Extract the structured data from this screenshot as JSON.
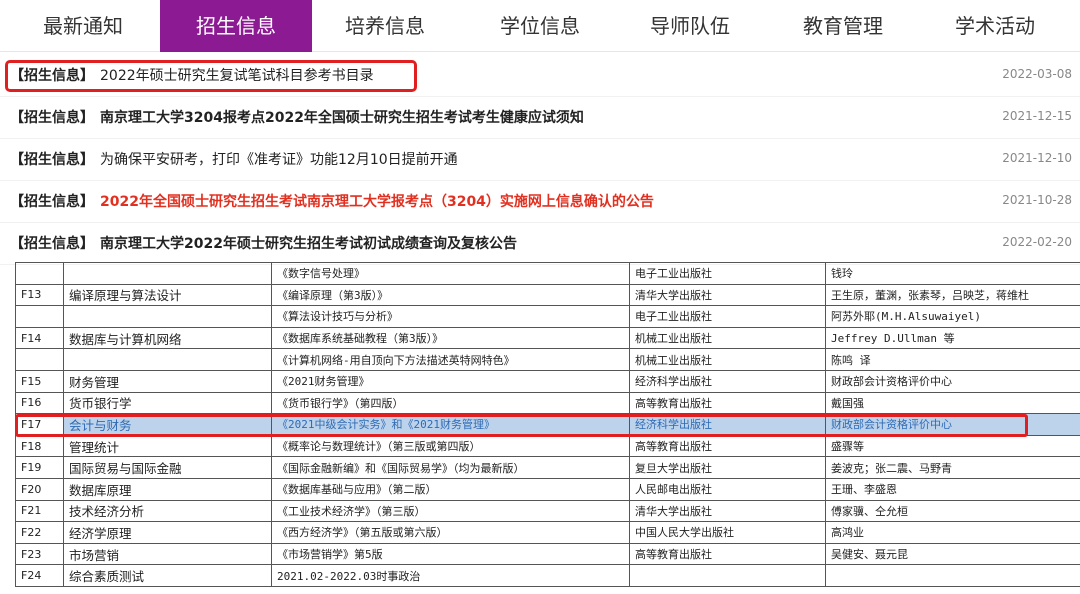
{
  "nav": {
    "tabs": [
      "最新通知",
      "招生信息",
      "培养信息",
      "学位信息",
      "导师队伍",
      "教育管理",
      "学术活动"
    ],
    "active_index": 1
  },
  "news": [
    {
      "tag": "【招生信息】",
      "title": "2022年硕士研究生复试笔试科目参考书目录",
      "date": "2022-03-08",
      "style": "normal"
    },
    {
      "tag": "【招生信息】",
      "title": "南京理工大学3204报考点2022年全国硕士研究生招生考试考生健康应试须知",
      "date": "2021-12-15",
      "style": "bold"
    },
    {
      "tag": "【招生信息】",
      "title": "为确保平安研考，打印《准考证》功能12月10日提前开通",
      "date": "2021-12-10",
      "style": "normal"
    },
    {
      "tag": "【招生信息】",
      "title": "2022年全国硕士研究生招生考试南京理工大学报考点（3204）实施网上信息确认的公告",
      "date": "2021-10-28",
      "style": "red"
    },
    {
      "tag": "【招生信息】",
      "title": "南京理工大学2022年硕士研究生招生考试初试成绩查询及复核公告",
      "date": "2022-02-20",
      "style": "bold"
    }
  ],
  "table": {
    "rows": [
      [
        "",
        "",
        "《数字信号处理》",
        "电子工业出版社",
        "钱玲"
      ],
      [
        "F13",
        "编译原理与算法设计",
        "《编译原理（第3版）》",
        "清华大学出版社",
        "王生原，董渊，张素琴，吕映芝，蒋维杜"
      ],
      [
        "",
        "",
        "《算法设计技巧与分析》",
        "电子工业出版社",
        "阿苏外耶(M.H.Alsuwaiyel)"
      ],
      [
        "F14",
        "数据库与计算机网络",
        "《数据库系统基础教程（第3版）》",
        "机械工业出版社",
        "Jeffrey D.Ullman 等"
      ],
      [
        "",
        "",
        "《计算机网络-用自顶向下方法描述英特网特色》",
        "机械工业出版社",
        "陈鸣 译"
      ],
      [
        "F15",
        "财务管理",
        "《2021财务管理》",
        "经济科学出版社",
        "财政部会计资格评价中心"
      ],
      [
        "F16",
        "货币银行学",
        "《货币银行学》（第四版）",
        "高等教育出版社",
        "戴国强"
      ],
      [
        "F17",
        "会计与财务",
        "《2021中级会计实务》和《2021财务管理》",
        "经济科学出版社",
        "财政部会计资格评价中心"
      ],
      [
        "F18",
        "管理统计",
        "《概率论与数理统计》（第三版或第四版）",
        "高等教育出版社",
        "盛骤等"
      ],
      [
        "F19",
        "国际贸易与国际金融",
        "《国际金融新编》和《国际贸易学》（均为最新版）",
        "复旦大学出版社",
        "姜波克；张二震、马野青"
      ],
      [
        "F20",
        "数据库原理",
        "《数据库基础与应用》（第二版）",
        "人民邮电出版社",
        "王珊、李盛恩"
      ],
      [
        "F21",
        "技术经济分析",
        "《工业技术经济学》（第三版）",
        "清华大学出版社",
        "傅家骥、仝允桓"
      ],
      [
        "F22",
        "经济学原理",
        "《西方经济学》（第五版或第六版）",
        "中国人民大学出版社",
        "高鸿业"
      ],
      [
        "F23",
        "市场营销",
        "《市场营销学》第5版",
        "高等教育出版社",
        "吴健安、聂元昆"
      ],
      [
        "F24",
        "综合素质测试",
        "2021.02-2022.03时事政治",
        "",
        ""
      ]
    ]
  }
}
